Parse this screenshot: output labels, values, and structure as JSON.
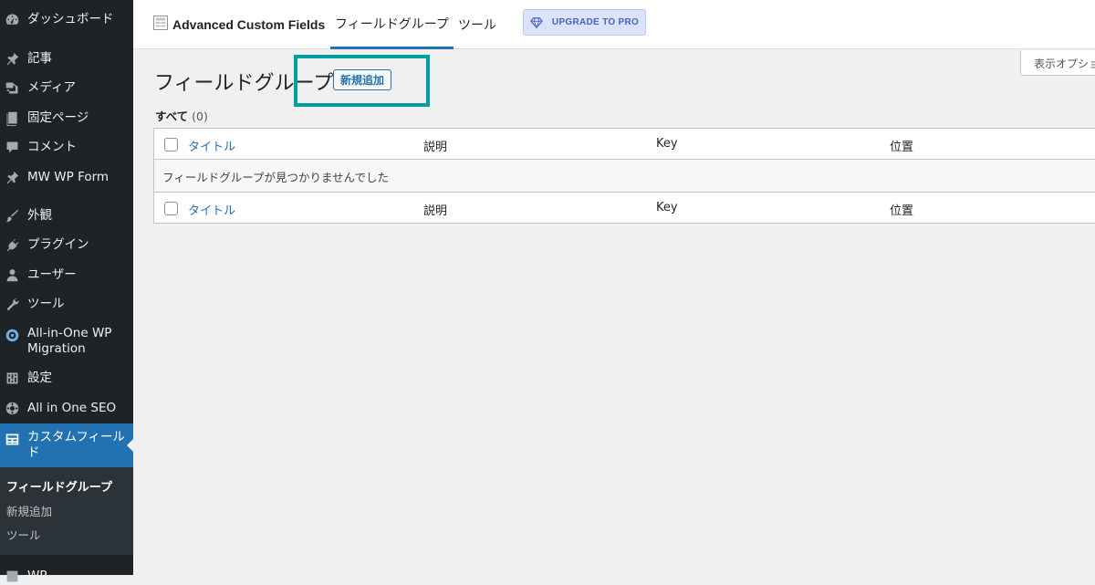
{
  "sidebar": {
    "items": [
      {
        "label": "ダッシュボード",
        "icon": "dashboard-icon"
      },
      {
        "label": "記事",
        "icon": "pin-icon"
      },
      {
        "label": "メディア",
        "icon": "media-icon"
      },
      {
        "label": "固定ページ",
        "icon": "page-icon"
      },
      {
        "label": "コメント",
        "icon": "comment-icon"
      },
      {
        "label": "MW WP Form",
        "icon": "pin-icon"
      },
      {
        "label": "外観",
        "icon": "brush-icon"
      },
      {
        "label": "プラグイン",
        "icon": "plugin-icon"
      },
      {
        "label": "ユーザー",
        "icon": "user-icon"
      },
      {
        "label": "ツール",
        "icon": "wrench-icon"
      },
      {
        "label": "All-in-One WP Migration",
        "icon": "migration-icon"
      },
      {
        "label": "設定",
        "icon": "settings-icon"
      },
      {
        "label": "All in One SEO",
        "icon": "seo-icon"
      },
      {
        "label": "カスタムフィールド",
        "icon": "custom-fields-icon"
      },
      {
        "label": "WP...",
        "icon": "generic-icon"
      }
    ],
    "submenu": [
      {
        "label": "フィールドグループ"
      },
      {
        "label": "新規追加"
      },
      {
        "label": "ツール"
      }
    ]
  },
  "topbar": {
    "brand": "Advanced Custom Fields",
    "brand_icon": "acf-table-icon",
    "tabs": [
      {
        "label": "フィールドグループ",
        "active": true
      },
      {
        "label": "ツール",
        "active": false
      }
    ],
    "upgrade_label": "UPGRADE TO PRO",
    "upgrade_icon": "diamond-icon"
  },
  "screen_options_label": "表示オプション",
  "heading": {
    "title": "フィールドグループ",
    "add_new_label": "新規追加"
  },
  "filter": {
    "all_label": "すべて",
    "count": "(0)"
  },
  "table": {
    "columns": [
      "タイトル",
      "説明",
      "Key",
      "位置"
    ],
    "empty_message": "フィールドグループが見つかりませんでした"
  },
  "colors": {
    "sidebar_bg": "#1d2327",
    "accent": "#2271b1",
    "highlight": "#00a0a0",
    "upgrade_bg": "#dbe3fb"
  }
}
